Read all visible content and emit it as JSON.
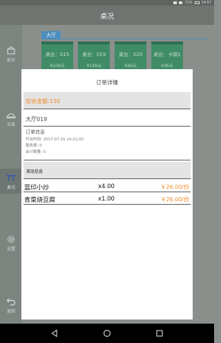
{
  "status": {
    "battery": "71%",
    "time": "14:57"
  },
  "app": {
    "title": "桌况"
  },
  "sidebar": {
    "items": [
      {
        "label": "前台",
        "icon": "basket-icon"
      },
      {
        "label": "点菜",
        "icon": "cloche-icon"
      },
      {
        "label": "桌况",
        "icon": "table-icon"
      },
      {
        "label": "设置",
        "icon": "gear-icon"
      },
      {
        "label": "返回",
        "icon": "back-icon"
      }
    ]
  },
  "area": {
    "tab": "大厅"
  },
  "tables": [
    {
      "name": "桌台：015",
      "amount": "¥104元"
    },
    {
      "name": "桌台：019",
      "amount": "¥130元"
    },
    {
      "name": "桌台：020",
      "amount": "¥26元"
    },
    {
      "name": "桌台：卡钢1",
      "amount": "¥36元"
    }
  ],
  "modal": {
    "title": "订单详情",
    "amount_label": "应收金额:130",
    "hall_name": "大厅019",
    "order_info": {
      "heading": "订单信息",
      "open_time": "开台时间: 2017-07-15 14:21:00",
      "service_fee": "服务费: 0",
      "count": "会计数量: 5"
    },
    "dishes": {
      "heading": "菜品信息",
      "rows": [
        {
          "name": "蓝印小炒",
          "qty": "x4.00",
          "price": "￥26.00/份"
        },
        {
          "name": "青菜烧豆腐",
          "qty": "x1.00",
          "price": "￥26.00/份"
        }
      ]
    }
  },
  "colors": {
    "accent_orange": "#f08a2a",
    "table_green": "#3f8c67",
    "area_blue": "#4a8ebf"
  }
}
